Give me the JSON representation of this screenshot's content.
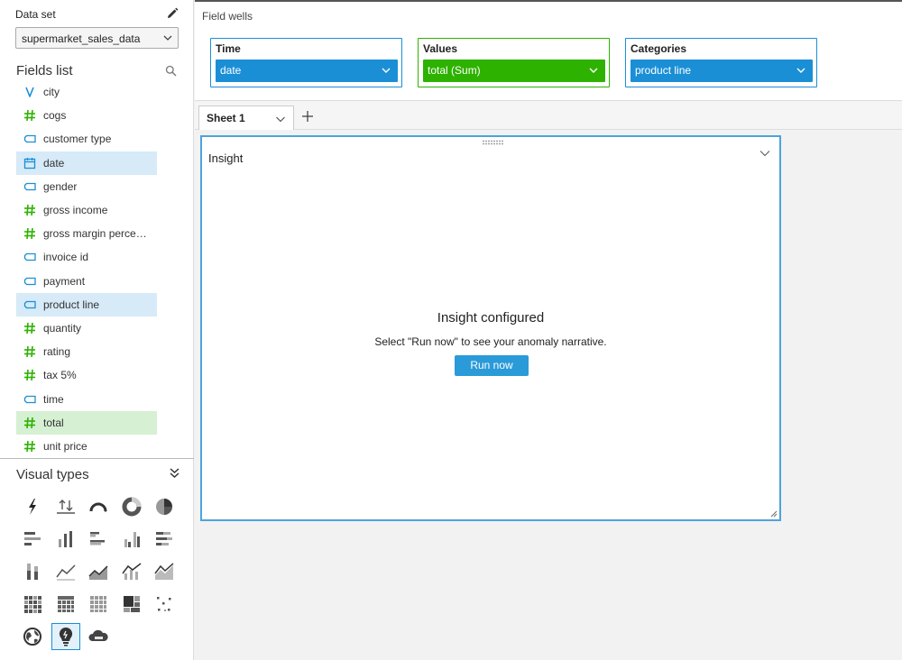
{
  "dataset": {
    "label": "Data set",
    "selected": "supermarket_sales_data",
    "edit_icon": "pencil-icon"
  },
  "fields_list": {
    "title": "Fields list",
    "search_icon": "search-icon",
    "items": [
      {
        "label": "city",
        "type": "geo",
        "selected": "none"
      },
      {
        "label": "cogs",
        "type": "measure",
        "selected": "none"
      },
      {
        "label": "customer type",
        "type": "dimension",
        "selected": "none"
      },
      {
        "label": "date",
        "type": "date",
        "selected": "blue"
      },
      {
        "label": "gender",
        "type": "dimension",
        "selected": "none"
      },
      {
        "label": "gross income",
        "type": "measure",
        "selected": "none"
      },
      {
        "label": "gross margin perce…",
        "type": "measure",
        "selected": "none"
      },
      {
        "label": "invoice id",
        "type": "dimension",
        "selected": "none"
      },
      {
        "label": "payment",
        "type": "dimension",
        "selected": "none"
      },
      {
        "label": "product line",
        "type": "dimension",
        "selected": "blue"
      },
      {
        "label": "quantity",
        "type": "measure",
        "selected": "none"
      },
      {
        "label": "rating",
        "type": "measure",
        "selected": "none"
      },
      {
        "label": "tax 5%",
        "type": "measure",
        "selected": "none"
      },
      {
        "label": "time",
        "type": "dimension",
        "selected": "none"
      },
      {
        "label": "total",
        "type": "measure",
        "selected": "green"
      },
      {
        "label": "unit price",
        "type": "measure",
        "selected": "none"
      }
    ]
  },
  "visual_types": {
    "title": "Visual types",
    "collapse_icon": "double-chevron-down-icon",
    "items": [
      {
        "icon": "autograph-icon",
        "selected": false
      },
      {
        "icon": "kpi-icon",
        "selected": false
      },
      {
        "icon": "gauge-icon",
        "selected": false
      },
      {
        "icon": "donut-chart-icon",
        "selected": false
      },
      {
        "icon": "pie-chart-icon",
        "selected": false
      },
      {
        "icon": "horizontal-bar-icon",
        "selected": false
      },
      {
        "icon": "vertical-bar-icon",
        "selected": false
      },
      {
        "icon": "clustered-horizontal-bar-icon",
        "selected": false
      },
      {
        "icon": "clustered-vertical-bar-icon",
        "selected": false
      },
      {
        "icon": "stacked-horizontal-bar-icon",
        "selected": false
      },
      {
        "icon": "stacked-vertical-bar-icon",
        "selected": false
      },
      {
        "icon": "line-chart-icon",
        "selected": false
      },
      {
        "icon": "area-line-chart-icon",
        "selected": false
      },
      {
        "icon": "combo-chart-icon",
        "selected": false
      },
      {
        "icon": "combo-line-chart-icon",
        "selected": false
      },
      {
        "icon": "heat-map-icon",
        "selected": false
      },
      {
        "icon": "pivot-table-icon",
        "selected": false
      },
      {
        "icon": "table-icon",
        "selected": false
      },
      {
        "icon": "tree-map-icon",
        "selected": false
      },
      {
        "icon": "scatter-plot-icon",
        "selected": false
      },
      {
        "icon": "geospatial-map-icon",
        "selected": false
      },
      {
        "icon": "insight-lightbulb-icon",
        "selected": true
      },
      {
        "icon": "word-cloud-icon",
        "selected": false
      }
    ]
  },
  "field_wells": {
    "title": "Field wells",
    "wells": [
      {
        "title": "Time",
        "value": "date",
        "color": "#1a8fd6"
      },
      {
        "title": "Values",
        "value": "total (Sum)",
        "color": "#2db200"
      },
      {
        "title": "Categories",
        "value": "product line",
        "color": "#1a8fd6"
      }
    ]
  },
  "sheets": {
    "tabs": [
      {
        "label": "Sheet 1"
      }
    ],
    "add_icon": "plus-icon"
  },
  "insight": {
    "title": "Insight",
    "heading": "Insight configured",
    "message": "Select \"Run now\" to see your anomaly narrative.",
    "button_label": "Run now",
    "accent": "#2a9ad9"
  }
}
